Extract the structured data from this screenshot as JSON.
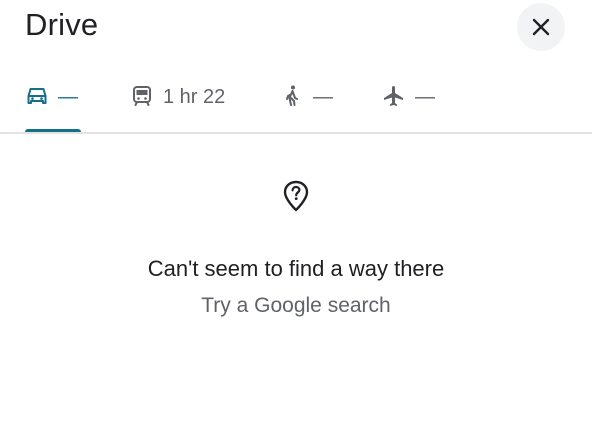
{
  "header": {
    "title": "Drive",
    "close_icon": "close-icon"
  },
  "travel_modes": [
    {
      "mode": "drive",
      "icon": "car-icon",
      "value": "—",
      "selected": true
    },
    {
      "mode": "transit",
      "icon": "train-icon",
      "value": "1 hr 22",
      "selected": false
    },
    {
      "mode": "walk",
      "icon": "walking-person-icon",
      "value": "—",
      "selected": false
    },
    {
      "mode": "flight",
      "icon": "airplane-icon",
      "value": "—",
      "selected": false
    }
  ],
  "empty_state": {
    "icon": "location-question-icon",
    "title": "Can't seem to find a way there",
    "link": "Try a Google search"
  },
  "colors": {
    "accent": "#14708a",
    "text_primary": "#202124",
    "text_secondary": "#5f6368",
    "close_button_bg": "#f1f3f4",
    "divider": "#e3e3e3"
  }
}
